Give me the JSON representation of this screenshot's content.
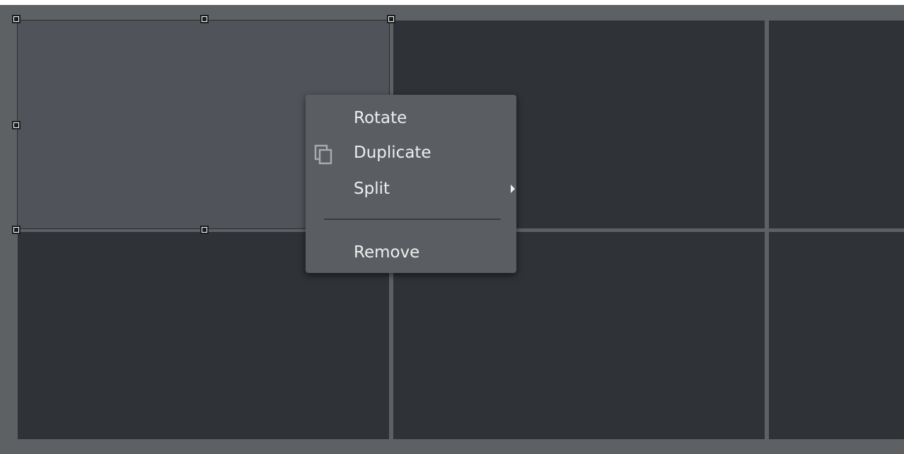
{
  "context_menu": {
    "items": [
      {
        "label": "Rotate",
        "icon": "",
        "submenu": false
      },
      {
        "label": "Duplicate",
        "icon": "duplicate-icon",
        "submenu": false
      },
      {
        "label": "Split",
        "icon": "",
        "submenu": true
      }
    ],
    "after_separator": [
      {
        "label": "Remove",
        "icon": "",
        "submenu": false
      }
    ]
  },
  "colors": {
    "background": "#5e6164",
    "cell": "#2f3236",
    "cell_selected": "#50545a",
    "menu_bg": "#5a5e62",
    "menu_text": "#eeeeee"
  }
}
